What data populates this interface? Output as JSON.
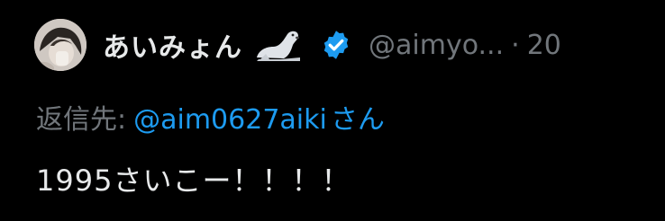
{
  "tweet": {
    "author": {
      "display_name": "あいみょん",
      "emoji_icon": "seal-emoji-icon",
      "verified_icon": "verified-badge-icon",
      "handle": "@aimyo...",
      "separator": "·",
      "date": "20"
    },
    "reply": {
      "label": "返信先:",
      "handle": "@aim0627aiki",
      "suffix": "さん"
    },
    "text": "1995さいこー！！！！"
  },
  "colors": {
    "background": "#000000",
    "primary_text": "#e7e9ea",
    "secondary_text": "#71767b",
    "link": "#1d9bf0",
    "verified_badge": "#1d9bf0"
  }
}
